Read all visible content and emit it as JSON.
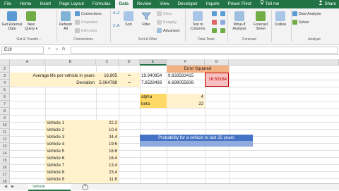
{
  "tabs": [
    "File",
    "Home",
    "Insert",
    "Page Layout",
    "Formulas",
    "Data",
    "Review",
    "View",
    "Developer",
    "Inquire",
    "Power Pivot"
  ],
  "tell_me": "Tell me",
  "share": "Share",
  "ribbon": {
    "get_external_data": "Get External Data",
    "new_query": "New Query",
    "refresh_all": "Refresh All",
    "connections": "Connections",
    "properties": "Properties",
    "edit_links": "Edit Links",
    "sort": "Sort",
    "filter": "Filter",
    "clear": "Clear",
    "reapply": "Reapply",
    "advanced": "Advanced",
    "text_to_columns": "Text to Columns",
    "what_if": "What-If Analysis",
    "forecast_sheet": "Forecast Sheet",
    "outline": "Outline",
    "data_analysis": "Data Analysis",
    "solver": "Solver",
    "grp_get": "Get & Transfo...",
    "grp_conn": "Connections",
    "grp_sort": "Sort & Filter",
    "grp_tools": "Data Tools",
    "grp_forecast": "Forecast",
    "grp_analyze": "Analyze",
    "sort_az": "A↓Z",
    "sort_za": "Z↓A",
    "dropdown_mark": "▾"
  },
  "formula_bar": {
    "name_box": "E19",
    "fx": "fx",
    "cancel": "×",
    "enter": "✓",
    "value": ""
  },
  "columns": [
    "A",
    "B",
    "C",
    "D",
    "E",
    "F",
    "G"
  ],
  "rows": [
    "2",
    "3",
    "4",
    "5",
    "6",
    "7",
    "8",
    "9",
    "10",
    "11",
    "12",
    "13",
    "14",
    "15",
    "16",
    "17",
    "18"
  ],
  "cells": {
    "f2": "Error Squared",
    "a3": "Average life per vehicle in years",
    "c3": "16.805",
    "d3": "=",
    "e3": "19.940854",
    "f3": "9.833583415",
    "g3": "16.53164",
    "b4": "Deviation",
    "c4": "5.064788",
    "d4": "=",
    "e4": "7.6528483",
    "f4": "6.698055608",
    "e6": "alpha",
    "f6": "4",
    "e7": "beta",
    "f7": "22",
    "prob": "Probability for a vehicle to last 25 years"
  },
  "vehicles": [
    {
      "name": "Vehicle 1",
      "value": "22.2"
    },
    {
      "name": "Vehicle 2",
      "value": "10.4"
    },
    {
      "name": "Vehicle 3",
      "value": "24.4"
    },
    {
      "name": "Vehicle 4",
      "value": "19.6"
    },
    {
      "name": "Vehicle 5",
      "value": "16.6"
    },
    {
      "name": "Vehicle 6",
      "value": "16.4"
    },
    {
      "name": "Vehicle 7",
      "value": "13.4"
    },
    {
      "name": "Vehicle 8",
      "value": "23.4"
    },
    {
      "name": "Vehicle 9",
      "value": "11.6"
    }
  ],
  "sheet_tab": "Vehicle",
  "colors": {
    "green": "#217346",
    "salmon": "#f4b183",
    "pink": "#f8c1c1",
    "yellow": "#fff2cc",
    "gold": "#ffd966",
    "blue": "#4472c4"
  }
}
